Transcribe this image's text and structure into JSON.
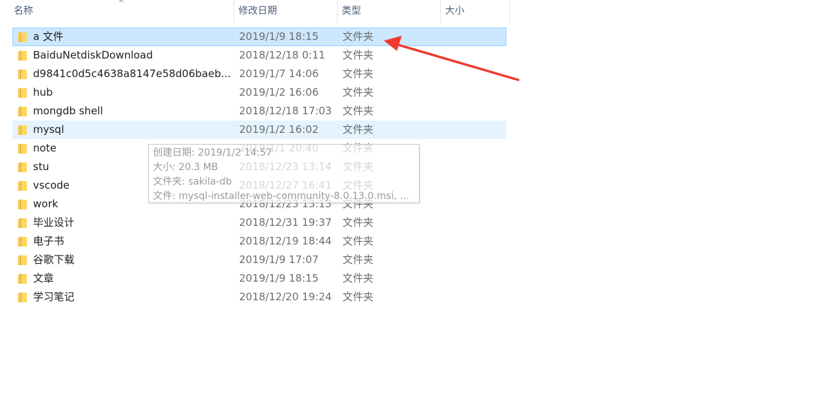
{
  "header": {
    "name": "名称",
    "modified": "修改日期",
    "type": "类型",
    "size": "大小"
  },
  "files": [
    {
      "name": "a 文件",
      "modified": "2019/1/9 18:15",
      "type": "文件夹",
      "state": "selected"
    },
    {
      "name": "BaiduNetdiskDownload",
      "modified": "2018/12/18 0:11",
      "type": "文件夹"
    },
    {
      "name": "d9841c0d5c4638a8147e58d06baeb...",
      "modified": "2019/1/7 14:06",
      "type": "文件夹"
    },
    {
      "name": "hub",
      "modified": "2019/1/2 16:06",
      "type": "文件夹"
    },
    {
      "name": "mongdb shell",
      "modified": "2018/12/18 17:03",
      "type": "文件夹"
    },
    {
      "name": "mysql",
      "modified": "2019/1/2 16:02",
      "type": "文件夹",
      "state": "hover"
    },
    {
      "name": "note",
      "modified": "2019/1/1 20:40",
      "type": "文件夹"
    },
    {
      "name": "stu",
      "modified": "2018/12/23 13:14",
      "type": "文件夹"
    },
    {
      "name": "vscode",
      "modified": "2018/12/27 16:41",
      "type": "文件夹"
    },
    {
      "name": "work",
      "modified": "2018/12/23 13:13",
      "type": "文件夹"
    },
    {
      "name": "毕业设计",
      "modified": "2018/12/31 19:37",
      "type": "文件夹"
    },
    {
      "name": "电子书",
      "modified": "2018/12/19 18:44",
      "type": "文件夹"
    },
    {
      "name": "谷歌下载",
      "modified": "2019/1/9 17:07",
      "type": "文件夹"
    },
    {
      "name": "文章",
      "modified": "2019/1/9 18:15",
      "type": "文件夹"
    },
    {
      "name": "学习笔记",
      "modified": "2018/12/20 19:24",
      "type": "文件夹"
    }
  ],
  "tooltip": {
    "created": "创建日期: 2019/1/2 14:57",
    "size": "大小: 20.3 MB",
    "folders": "文件夹: sakila-db",
    "files": "文件: mysql-installer-web-community-8.0.13.0.msi, ..."
  },
  "colors": {
    "selected_bg": "#cce8ff",
    "hover_bg": "#e5f3ff",
    "annotation_arrow": "#f03a2e",
    "folder": "#f8cd5a"
  }
}
